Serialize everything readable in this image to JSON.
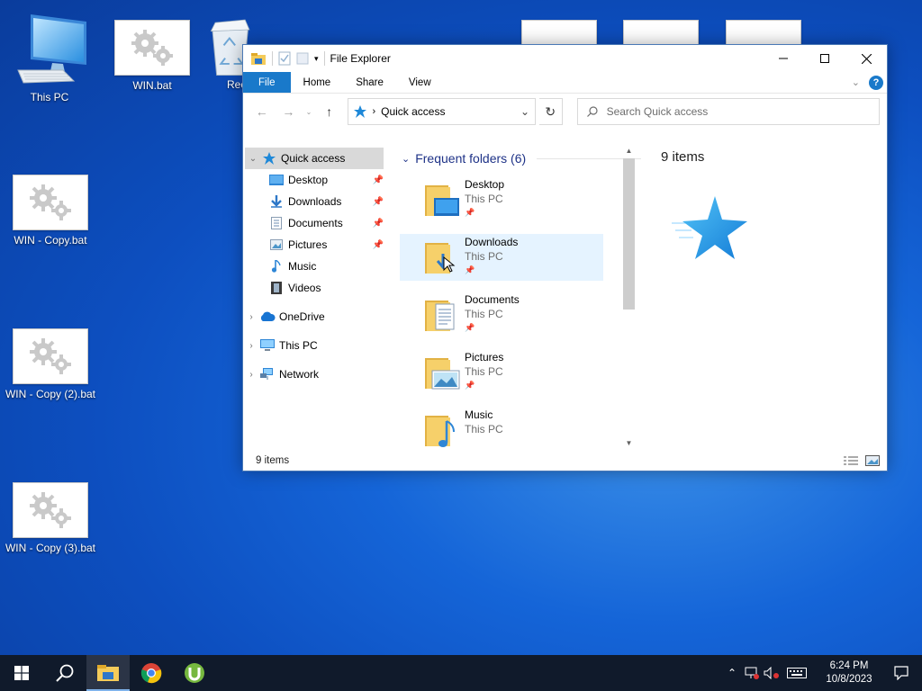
{
  "desktop": {
    "icons": {
      "this_pc": "This PC",
      "win_bat": "WIN.bat",
      "recycle": "Rec",
      "win_copy": "WIN - Copy.bat",
      "win_copy2": "WIN - Copy (2).bat",
      "win_copy3": "WIN - Copy (3).bat"
    }
  },
  "explorer": {
    "title": "File Explorer",
    "ribbon_tabs": [
      "File",
      "Home",
      "Share",
      "View"
    ],
    "address": "Quick access",
    "search_placeholder": "Search Quick access",
    "nav": {
      "quick_access": "Quick access",
      "desktop": "Desktop",
      "downloads": "Downloads",
      "documents": "Documents",
      "pictures": "Pictures",
      "music": "Music",
      "videos": "Videos",
      "onedrive": "OneDrive",
      "this_pc": "This PC",
      "network": "Network"
    },
    "group_header": "Frequent folders (6)",
    "folders": [
      {
        "name": "Desktop",
        "location": "This PC"
      },
      {
        "name": "Downloads",
        "location": "This PC"
      },
      {
        "name": "Documents",
        "location": "This PC"
      },
      {
        "name": "Pictures",
        "location": "This PC"
      },
      {
        "name": "Music",
        "location": "This PC"
      }
    ],
    "preview_count": "9 items",
    "status": "9 items"
  },
  "taskbar": {
    "time": "6:24 PM",
    "date": "10/8/2023"
  },
  "colors": {
    "accent": "#1979ca",
    "folder_yellow": "#f4cb5a",
    "taskbar": "#101a2b"
  }
}
